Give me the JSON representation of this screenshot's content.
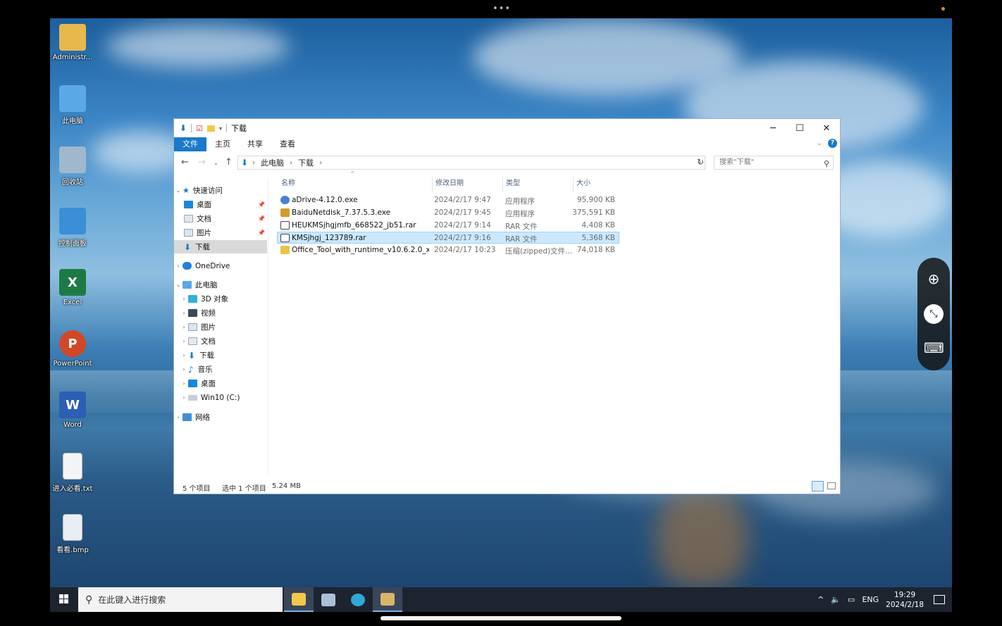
{
  "desktop": {
    "icons": [
      {
        "label": "Administr...",
        "icon": "user-folder-icon",
        "color": "#e8b84a"
      },
      {
        "label": "此电脑",
        "icon": "computer-icon",
        "color": "#5aa8e6"
      },
      {
        "label": "回收站",
        "icon": "recycle-bin-icon",
        "color": "#9fb8cc"
      },
      {
        "label": "控制面板",
        "icon": "control-panel-icon",
        "color": "#3a8fd6"
      },
      {
        "label": "Excel",
        "icon": "excel-icon",
        "color": "#1d7a45",
        "letter": "X"
      },
      {
        "label": "PowerPoint",
        "icon": "powerpoint-icon",
        "color": "#d24726",
        "letter": "P"
      },
      {
        "label": "Word",
        "icon": "word-icon",
        "color": "#2b5fb3",
        "letter": "W"
      },
      {
        "label": "进入必看.txt",
        "icon": "text-file-icon",
        "color": "#f4f4f4"
      },
      {
        "label": "看看.bmp",
        "icon": "image-file-icon",
        "color": "#e8eef4"
      }
    ]
  },
  "explorer": {
    "title": "下载",
    "ribbon_tabs": [
      "文件",
      "主页",
      "共享",
      "查看"
    ],
    "address": {
      "crumbs": [
        "此电脑",
        "下载"
      ]
    },
    "search_placeholder": "搜索\"下载\"",
    "nav": {
      "quick_access": "快速访问",
      "quick_items": [
        "桌面",
        "文档",
        "图片",
        "下载"
      ],
      "onedrive": "OneDrive",
      "this_pc": "此电脑",
      "pc_items": [
        "3D 对象",
        "视频",
        "图片",
        "文档",
        "下载",
        "音乐",
        "桌面",
        "Win10 (C:)"
      ],
      "network": "网络"
    },
    "columns": {
      "name": "名称",
      "date": "修改日期",
      "type": "类型",
      "size": "大小"
    },
    "files": [
      {
        "name": "aDrive-4.12.0.exe",
        "date": "2024/2/17 9:47",
        "type": "应用程序",
        "size": "95,900 KB",
        "color": "#4a7fd6"
      },
      {
        "name": "BaiduNetdisk_7.37.5.3.exe",
        "date": "2024/2/17 9:45",
        "type": "应用程序",
        "size": "375,591 KB",
        "color": "#d49a2a"
      },
      {
        "name": "HEUKMSjhgjmfb_668522_jb51.rar",
        "date": "2024/2/17 9:14",
        "type": "RAR 文件",
        "size": "4,408 KB",
        "color": "#444444"
      },
      {
        "name": "KMSjhgj_123789.rar",
        "date": "2024/2/17 9:16",
        "type": "RAR 文件",
        "size": "5,368 KB",
        "color": "#444444"
      },
      {
        "name": "Office_Tool_with_runtime_v10.6.2.0_x6...",
        "date": "2024/2/17 10:23",
        "type": "压缩(zipped)文件...",
        "size": "74,018 KB",
        "color": "#e9c44a"
      }
    ],
    "status": {
      "count": "5 个项目",
      "selected": "选中 1 个项目",
      "size": "5.24 MB"
    }
  },
  "taskbar": {
    "search_placeholder": "在此键入进行搜索",
    "lang": "ENG",
    "time": "19:29",
    "date": "2024/2/18"
  },
  "colors": {
    "accent": "#1979ca",
    "selection": "#cce8ff"
  }
}
